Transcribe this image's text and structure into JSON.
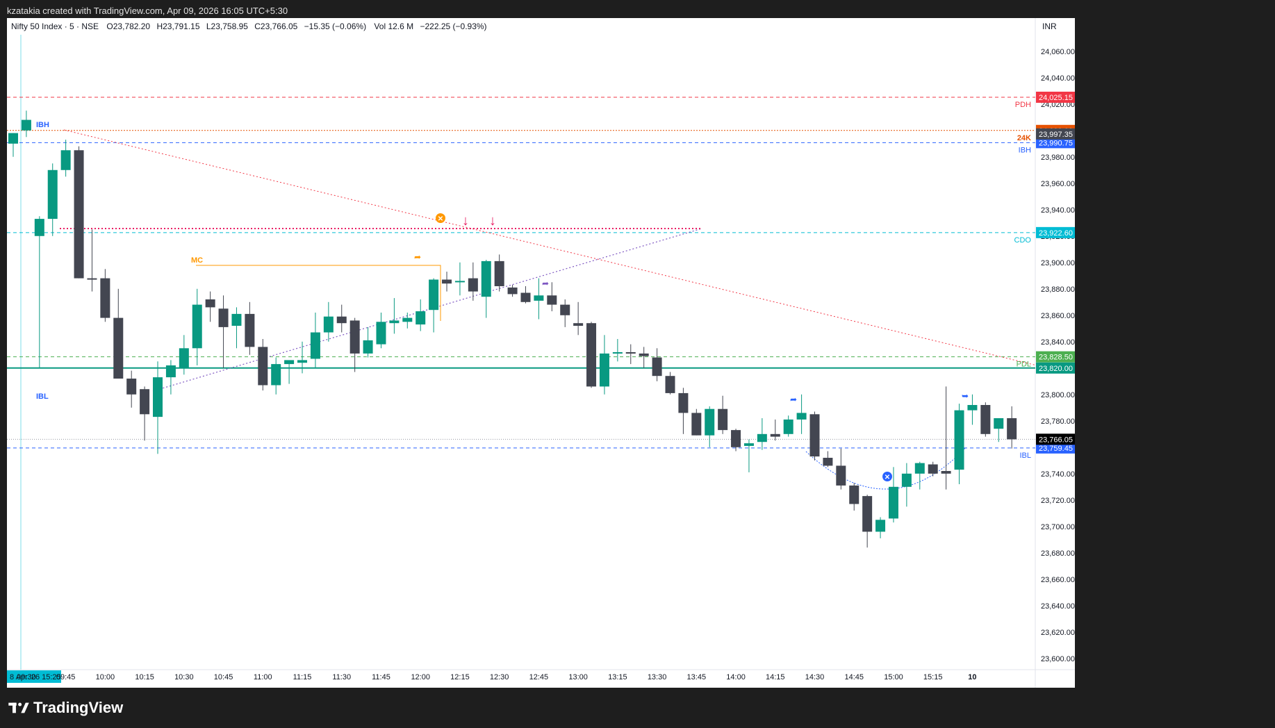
{
  "header": {
    "credit": "kzatakia created with TradingView.com, Apr 09, 2026 16:05 UTC+5:30"
  },
  "footer": {
    "brand": "TradingView"
  },
  "colors": {
    "up": "#089981",
    "down": "#434651",
    "accent": "#2962ff"
  },
  "chart_data": {
    "type": "candlestick",
    "legend": {
      "symbol": "Nifty 50 Index · 5 · NSE",
      "open": "O23,782.20",
      "high": "H23,791.15",
      "low": "L23,758.95",
      "close": "C23,766.05",
      "change": "−15.35 (−0.06%)",
      "volume_label": "Vol",
      "volume": "12.6 M",
      "day_change": "−222.25 (−0.93%)"
    },
    "currency": "INR",
    "y_range": [
      23600,
      24080
    ],
    "y_ticks": [
      "23,600.00",
      "23,620.00",
      "23,640.00",
      "23,660.00",
      "23,680.00",
      "23,700.00",
      "23,720.00",
      "23,740.00",
      "23,760.00",
      "23,780.00",
      "23,800.00",
      "23,820.00",
      "23,840.00",
      "23,860.00",
      "23,880.00",
      "23,900.00",
      "23,920.00",
      "23,940.00",
      "23,960.00",
      "23,980.00",
      "24,000.00",
      "24,020.00",
      "24,040.00",
      "24,060.00"
    ],
    "y_tick_values": [
      23600,
      23620,
      23640,
      23660,
      23680,
      23700,
      23720,
      23740,
      23760,
      23780,
      23800,
      23820,
      23840,
      23860,
      23880,
      23900,
      23920,
      23940,
      23960,
      23980,
      24000,
      24020,
      24040,
      24060
    ],
    "x_labels": [
      {
        "label": "8 Apr '26  15:25",
        "slot": -0.1
      },
      {
        "label": "09:30",
        "slot": 1
      },
      {
        "label": "09:45",
        "slot": 4
      },
      {
        "label": "10:00",
        "slot": 7
      },
      {
        "label": "10:15",
        "slot": 10
      },
      {
        "label": "10:30",
        "slot": 13
      },
      {
        "label": "10:45",
        "slot": 16
      },
      {
        "label": "11:00",
        "slot": 19
      },
      {
        "label": "11:15",
        "slot": 22
      },
      {
        "label": "11:30",
        "slot": 25
      },
      {
        "label": "11:45",
        "slot": 28
      },
      {
        "label": "12:00",
        "slot": 31
      },
      {
        "label": "12:15",
        "slot": 34
      },
      {
        "label": "12:30",
        "slot": 37
      },
      {
        "label": "12:45",
        "slot": 40
      },
      {
        "label": "13:00",
        "slot": 43
      },
      {
        "label": "13:15",
        "slot": 46
      },
      {
        "label": "13:30",
        "slot": 49
      },
      {
        "label": "13:45",
        "slot": 52
      },
      {
        "label": "14:00",
        "slot": 55
      },
      {
        "label": "14:15",
        "slot": 58
      },
      {
        "label": "14:30",
        "slot": 61
      },
      {
        "label": "14:45",
        "slot": 64
      },
      {
        "label": "15:00",
        "slot": 67
      },
      {
        "label": "15:15",
        "slot": 70
      },
      {
        "label": "10",
        "slot": 73
      }
    ],
    "candles": [
      {
        "o": 23990,
        "h": 23998,
        "l": 23980,
        "c": 23998
      },
      {
        "o": 24000,
        "h": 24015,
        "l": 23995,
        "c": 24008
      },
      {
        "o": 23920,
        "h": 23935,
        "l": 23820,
        "c": 23933
      },
      {
        "o": 23933,
        "h": 23975,
        "l": 23920,
        "c": 23970
      },
      {
        "o": 23970,
        "h": 23993,
        "l": 23965,
        "c": 23985
      },
      {
        "o": 23985,
        "h": 23988,
        "l": 23888,
        "c": 23888
      },
      {
        "o": 23888,
        "h": 23925,
        "l": 23878,
        "c": 23887
      },
      {
        "o": 23888,
        "h": 23895,
        "l": 23855,
        "c": 23858
      },
      {
        "o": 23858,
        "h": 23880,
        "l": 23815,
        "c": 23812
      },
      {
        "o": 23812,
        "h": 23818,
        "l": 23790,
        "c": 23800
      },
      {
        "o": 23804,
        "h": 23806,
        "l": 23765,
        "c": 23785
      },
      {
        "o": 23783,
        "h": 23825,
        "l": 23755,
        "c": 23813
      },
      {
        "o": 23813,
        "h": 23826,
        "l": 23800,
        "c": 23822
      },
      {
        "o": 23820,
        "h": 23845,
        "l": 23815,
        "c": 23835
      },
      {
        "o": 23835,
        "h": 23880,
        "l": 23822,
        "c": 23868
      },
      {
        "o": 23872,
        "h": 23878,
        "l": 23855,
        "c": 23866
      },
      {
        "o": 23865,
        "h": 23875,
        "l": 23820,
        "c": 23851
      },
      {
        "o": 23852,
        "h": 23866,
        "l": 23835,
        "c": 23861
      },
      {
        "o": 23861,
        "h": 23870,
        "l": 23830,
        "c": 23836
      },
      {
        "o": 23836,
        "h": 23842,
        "l": 23803,
        "c": 23807
      },
      {
        "o": 23807,
        "h": 23828,
        "l": 23800,
        "c": 23823
      },
      {
        "o": 23823,
        "h": 23825,
        "l": 23808,
        "c": 23826
      },
      {
        "o": 23824,
        "h": 23840,
        "l": 23816,
        "c": 23826
      },
      {
        "o": 23827,
        "h": 23862,
        "l": 23820,
        "c": 23847
      },
      {
        "o": 23847,
        "h": 23870,
        "l": 23840,
        "c": 23859
      },
      {
        "o": 23859,
        "h": 23868,
        "l": 23847,
        "c": 23854
      },
      {
        "o": 23856,
        "h": 23858,
        "l": 23817,
        "c": 23831
      },
      {
        "o": 23831,
        "h": 23851,
        "l": 23828,
        "c": 23841
      },
      {
        "o": 23838,
        "h": 23862,
        "l": 23835,
        "c": 23855
      },
      {
        "o": 23854,
        "h": 23873,
        "l": 23846,
        "c": 23856
      },
      {
        "o": 23855,
        "h": 23862,
        "l": 23850,
        "c": 23858
      },
      {
        "o": 23853,
        "h": 23872,
        "l": 23848,
        "c": 23863
      },
      {
        "o": 23864,
        "h": 23888,
        "l": 23847,
        "c": 23887
      },
      {
        "o": 23887,
        "h": 23893,
        "l": 23878,
        "c": 23884
      },
      {
        "o": 23885,
        "h": 23900,
        "l": 23875,
        "c": 23886
      },
      {
        "o": 23888,
        "h": 23900,
        "l": 23871,
        "c": 23878
      },
      {
        "o": 23874,
        "h": 23902,
        "l": 23858,
        "c": 23901
      },
      {
        "o": 23901,
        "h": 23906,
        "l": 23878,
        "c": 23882
      },
      {
        "o": 23881,
        "h": 23883,
        "l": 23874,
        "c": 23876
      },
      {
        "o": 23877,
        "h": 23882,
        "l": 23869,
        "c": 23870
      },
      {
        "o": 23871,
        "h": 23888,
        "l": 23857,
        "c": 23875
      },
      {
        "o": 23875,
        "h": 23885,
        "l": 23863,
        "c": 23868
      },
      {
        "o": 23868,
        "h": 23872,
        "l": 23851,
        "c": 23860
      },
      {
        "o": 23854,
        "h": 23870,
        "l": 23845,
        "c": 23852
      },
      {
        "o": 23854,
        "h": 23855,
        "l": 23805,
        "c": 23806
      },
      {
        "o": 23806,
        "h": 23845,
        "l": 23800,
        "c": 23831
      },
      {
        "o": 23831,
        "h": 23842,
        "l": 23825,
        "c": 23832
      },
      {
        "o": 23832,
        "h": 23838,
        "l": 23823,
        "c": 23831
      },
      {
        "o": 23831,
        "h": 23836,
        "l": 23820,
        "c": 23829
      },
      {
        "o": 23828,
        "h": 23835,
        "l": 23810,
        "c": 23814
      },
      {
        "o": 23814,
        "h": 23817,
        "l": 23800,
        "c": 23801
      },
      {
        "o": 23801,
        "h": 23805,
        "l": 23770,
        "c": 23786
      },
      {
        "o": 23786,
        "h": 23789,
        "l": 23769,
        "c": 23769
      },
      {
        "o": 23769,
        "h": 23791,
        "l": 23760,
        "c": 23789
      },
      {
        "o": 23789,
        "h": 23799,
        "l": 23770,
        "c": 23773
      },
      {
        "o": 23773,
        "h": 23774,
        "l": 23757,
        "c": 23760
      },
      {
        "o": 23761,
        "h": 23766,
        "l": 23741,
        "c": 23763
      },
      {
        "o": 23764,
        "h": 23782,
        "l": 23758,
        "c": 23770
      },
      {
        "o": 23770,
        "h": 23781,
        "l": 23765,
        "c": 23768
      },
      {
        "o": 23770,
        "h": 23784,
        "l": 23768,
        "c": 23781
      },
      {
        "o": 23781,
        "h": 23800,
        "l": 23770,
        "c": 23786
      },
      {
        "o": 23785,
        "h": 23787,
        "l": 23750,
        "c": 23753
      },
      {
        "o": 23752,
        "h": 23757,
        "l": 23745,
        "c": 23746
      },
      {
        "o": 23746,
        "h": 23759,
        "l": 23728,
        "c": 23731
      },
      {
        "o": 23731,
        "h": 23733,
        "l": 23712,
        "c": 23717
      },
      {
        "o": 23723,
        "h": 23724,
        "l": 23684,
        "c": 23696
      },
      {
        "o": 23696,
        "h": 23707,
        "l": 23691,
        "c": 23705
      },
      {
        "o": 23706,
        "h": 23745,
        "l": 23703,
        "c": 23730
      },
      {
        "o": 23730,
        "h": 23748,
        "l": 23715,
        "c": 23740
      },
      {
        "o": 23740,
        "h": 23749,
        "l": 23728,
        "c": 23748
      },
      {
        "o": 23747,
        "h": 23749,
        "l": 23738,
        "c": 23740
      },
      {
        "o": 23742,
        "h": 23806,
        "l": 23728,
        "c": 23740
      },
      {
        "o": 23743,
        "h": 23793,
        "l": 23732,
        "c": 23788
      },
      {
        "o": 23788,
        "h": 23800,
        "l": 23777,
        "c": 23792
      },
      {
        "o": 23792,
        "h": 23794,
        "l": 23768,
        "c": 23770
      },
      {
        "o": 23774,
        "h": 23779,
        "l": 23764,
        "c": 23782
      },
      {
        "o": 23782,
        "h": 23791,
        "l": 23759,
        "c": 23766
      }
    ],
    "price_lines": [
      {
        "label": "PDH",
        "value": 24025.15,
        "badge": "24,025.15",
        "color": "#f23645",
        "style": "dashed"
      },
      {
        "label": "24K",
        "value": 24000,
        "badge": "24,000.00",
        "color": "#e65100",
        "style": "dotted"
      },
      {
        "label": "IBH",
        "value": 23990.75,
        "badge": "23,990.75",
        "color": "#2962ff",
        "style": "dashed"
      },
      {
        "label": "CDO",
        "value": 23922.6,
        "badge": "23,922.60",
        "color": "#00bcd4",
        "style": "dashed"
      },
      {
        "label": "PDL",
        "value": 23828.5,
        "badge": "23,828.50",
        "color": "#4caf50",
        "style": "dashed"
      },
      {
        "label": "",
        "value": 23820,
        "badge": "23,820.00",
        "color": "#089981",
        "style": "solid"
      },
      {
        "label": "IBL",
        "value": 23759.45,
        "badge": "23,759.45",
        "color": "#2962ff",
        "style": "dashed"
      }
    ],
    "extra_badges": [
      {
        "value": 23997.35,
        "badge": "23,997.35",
        "color": "#434651"
      },
      {
        "value": 23766.05,
        "badge": "23,766.05",
        "color": "#000000"
      }
    ],
    "annotations": {
      "mc_label": "MC",
      "ibh_label": "IBH",
      "ibl_label": "IBL"
    }
  }
}
